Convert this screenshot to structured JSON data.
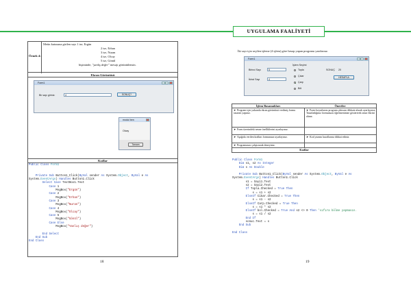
{
  "header": {
    "banner": "UYGULAMA FAALİYETİ"
  },
  "left_page": {
    "example_label": "Örnek 4:",
    "example_lines": [
      "Metin kutusuna girilen sayı 1 ise, Ergün",
      "2 ise, Erhan",
      "3 ise, Nuran",
      "4 ise, Olcay",
      "5 ise, Gönül"
    ],
    "example_last_prefix": "bişiminde, ",
    "example_last_quote": "\"yanlış değer\"",
    "example_last_suffix": " mesajı görüntülensin.",
    "screen_title": "Ekran Görüntüsü",
    "form1": {
      "title": "Form1",
      "label": "Bir sayı giriniz:",
      "input_value": "4",
      "button": "SONUÇ?"
    },
    "msgbox": {
      "title": "modul ben",
      "message": "Olcay",
      "button": "Tamam"
    },
    "codes_title": "Kodlar",
    "code_lines": [
      [
        [
          "kw",
          "Public Class "
        ],
        [
          "ty",
          "Form1"
        ]
      ],
      [],
      [],
      [
        [
          "",
          "    "
        ],
        [
          "kw",
          "Private Sub "
        ],
        [
          "",
          "Button1_Click("
        ],
        [
          "kw",
          "ByVal "
        ],
        [
          "",
          "sender "
        ],
        [
          "kw",
          "As "
        ],
        [
          "",
          "System."
        ],
        [
          "ty",
          "Object"
        ],
        [
          "",
          ", "
        ],
        [
          "kw",
          "ByVal "
        ],
        [
          "",
          "e "
        ],
        [
          "kw",
          "As"
        ]
      ],
      [
        [
          "",
          "System."
        ],
        [
          "ty",
          "EventArgs"
        ],
        [
          "",
          ") "
        ],
        [
          "kw",
          "Handles "
        ],
        [
          "",
          "Button1.Click"
        ]
      ],
      [
        [
          "",
          "        "
        ],
        [
          "kw",
          "Select Case "
        ],
        [
          "",
          "TextBox1.Text"
        ]
      ],
      [
        [
          "",
          "            "
        ],
        [
          "kw",
          "Case "
        ],
        [
          "",
          "1"
        ]
      ],
      [
        [
          "",
          "                MsgBox("
        ],
        [
          "st",
          "\"Ergün\""
        ],
        [
          "",
          ")"
        ]
      ],
      [
        [
          "",
          "            "
        ],
        [
          "kw",
          "Case "
        ],
        [
          "",
          "2"
        ]
      ],
      [
        [
          "",
          "                MsgBox("
        ],
        [
          "st",
          "\"Erhan\""
        ],
        [
          "",
          ")"
        ]
      ],
      [
        [
          "",
          "            "
        ],
        [
          "kw",
          "Case "
        ],
        [
          "",
          "3"
        ]
      ],
      [
        [
          "",
          "                MsgBox("
        ],
        [
          "st",
          "\"Nuran\""
        ],
        [
          "",
          ")"
        ]
      ],
      [
        [
          "",
          "            "
        ],
        [
          "kw",
          "Case "
        ],
        [
          "",
          "4"
        ]
      ],
      [
        [
          "",
          "                MsgBox("
        ],
        [
          "st",
          "\"Olcay\""
        ],
        [
          "",
          ")"
        ]
      ],
      [
        [
          "",
          "            "
        ],
        [
          "kw",
          "Case "
        ],
        [
          "",
          "5"
        ]
      ],
      [
        [
          "",
          "                MsgBox("
        ],
        [
          "st",
          "\"Gönül\""
        ],
        [
          "",
          ")"
        ]
      ],
      [
        [
          "",
          "            "
        ],
        [
          "kw",
          "Case Else"
        ]
      ],
      [
        [
          "",
          "                MsgBox("
        ],
        [
          "st",
          "\"Yanlış değer\""
        ],
        [
          "",
          ")"
        ]
      ],
      [],
      [
        [
          "",
          "        "
        ],
        [
          "kw",
          "End Select"
        ]
      ],
      [
        [
          "",
          "    "
        ],
        [
          "kw",
          "End Sub"
        ]
      ],
      [
        [
          "kw",
          "End Class"
        ]
      ]
    ],
    "page_number": "18"
  },
  "right_page": {
    "intro": "İki sayı için seçilen işleme (4 işlem) göre hesap yapan programı yazdırınız.",
    "form1": {
      "title": "Form1",
      "label1": "Birinci Sayı",
      "value1": "5",
      "label2": "İkinci Sayı",
      "value2": "4",
      "group": "İşlem Seçimi",
      "options": [
        "Topla",
        "Çıkar",
        "Çarp",
        "Böl"
      ],
      "selected_option": "Çarp",
      "result_label": "SONUÇ",
      "result_value": "20",
      "button": "HESAPLA"
    },
    "steps_header": {
      "steps": "İşlem Basamakları",
      "tips": "Öneriler"
    },
    "steps_rows": [
      {
        "step": "Program için yukarıda ekran görüntüsü verilmiş formu tasarım yapınız.",
        "tip": "Form boyutlarını program çıktısını dikkate alarak ayarlayınız. Tasarladığınız formunuzu öğretmeninize göstererek onun fikrini alınız."
      },
      {
        "step": "Form üzerindeki nesne özelliklerini ayarlayınız.",
        "tip": ""
      },
      {
        "step": "Aşağıda verilen kodları formunuza uyarlayınız.",
        "tip": "Kod yazımı kurallarına dikkat ediniz."
      },
      {
        "step": "Programınızı çalıştırarak deneyiniz.",
        "tip": ""
      }
    ],
    "codes_title": "Kodlar",
    "code_lines": [
      [
        [
          "kw",
          "Public Class "
        ],
        [
          "ty",
          "Form1"
        ]
      ],
      [
        [
          "",
          "    "
        ],
        [
          "kw",
          "Dim "
        ],
        [
          "",
          "s1, s2 "
        ],
        [
          "kw",
          "As Integer"
        ]
      ],
      [
        [
          "",
          "    "
        ],
        [
          "kw",
          "Dim "
        ],
        [
          "",
          "s "
        ],
        [
          "kw",
          "As Double"
        ]
      ],
      [],
      [
        [
          "",
          "    "
        ],
        [
          "kw",
          "Private Sub "
        ],
        [
          "",
          "Button1_Click("
        ],
        [
          "kw",
          "ByVal "
        ],
        [
          "",
          "sender "
        ],
        [
          "kw",
          "As "
        ],
        [
          "",
          "System."
        ],
        [
          "ty",
          "Object"
        ],
        [
          "",
          ", "
        ],
        [
          "kw",
          "ByVal "
        ],
        [
          "",
          "e "
        ],
        [
          "kw",
          "As"
        ]
      ],
      [
        [
          "",
          "System."
        ],
        [
          "ty",
          "EventArgs"
        ],
        [
          "",
          ") "
        ],
        [
          "kw",
          "Handles "
        ],
        [
          "",
          "Button1.Click"
        ]
      ],
      [
        [
          "",
          "        s1 = Sayi1.Text"
        ]
      ],
      [
        [
          "",
          "        s2 = Sayi2.Text"
        ]
      ],
      [
        [
          "",
          "        "
        ],
        [
          "kw",
          "If "
        ],
        [
          "",
          "Topla.Checked = "
        ],
        [
          "kw",
          "True Then"
        ]
      ],
      [
        [
          "",
          "            s = s1 + s2"
        ]
      ],
      [
        [
          "",
          "        "
        ],
        [
          "kw",
          "ElseIf "
        ],
        [
          "",
          "Cikar.Checked = "
        ],
        [
          "kw",
          "True Then"
        ]
      ],
      [
        [
          "",
          "            s = s1 - s2"
        ]
      ],
      [
        [
          "",
          "        "
        ],
        [
          "kw",
          "ElseIf "
        ],
        [
          "",
          "Carp.Checked = "
        ],
        [
          "kw",
          "True Then"
        ]
      ],
      [
        [
          "",
          "            s = s1 * s2"
        ]
      ],
      [
        [
          "",
          "        "
        ],
        [
          "kw",
          "ElseIf "
        ],
        [
          "",
          "bol.Checked = "
        ],
        [
          "kw",
          "True And "
        ],
        [
          "",
          "s2 <> 0 "
        ],
        [
          "kw",
          "Then "
        ],
        [
          "cm",
          "'sıfıra bölme yapmasın."
        ]
      ],
      [
        [
          "",
          "            s = s1 / s2"
        ]
      ],
      [
        [
          "",
          "        "
        ],
        [
          "kw",
          "End If"
        ]
      ],
      [
        [
          "",
          "        sonuc.Text = s"
        ]
      ],
      [
        [
          "",
          "    "
        ],
        [
          "kw",
          "End Sub"
        ]
      ],
      [],
      [
        [
          "kw",
          "End Class"
        ]
      ]
    ],
    "page_number": "19"
  }
}
